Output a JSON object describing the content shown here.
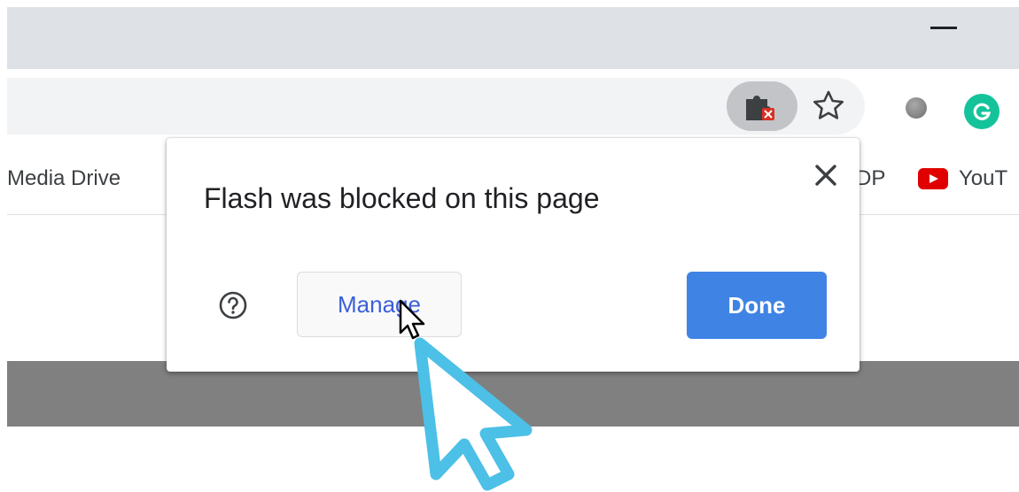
{
  "bookmarks": {
    "media_drive": "Media Drive",
    "dp_partial": "DP",
    "youtube_partial": "YouT"
  },
  "popup": {
    "title": "Flash was blocked on this page",
    "manage_label": "Manage",
    "done_label": "Done"
  },
  "icons": {
    "flash_blocked": "puzzle-blocked-icon",
    "bookmark_star": "star-icon",
    "extension": "extension-icon",
    "grammarly": "grammarly-icon",
    "close": "close-icon",
    "help": "help-icon",
    "youtube": "youtube-icon"
  },
  "colors": {
    "accent": "#3f84e5",
    "manage_text": "#3b5fd9",
    "arrow_outline": "#4cc0e6",
    "grammarly": "#15c39a",
    "youtube": "#e00000"
  }
}
